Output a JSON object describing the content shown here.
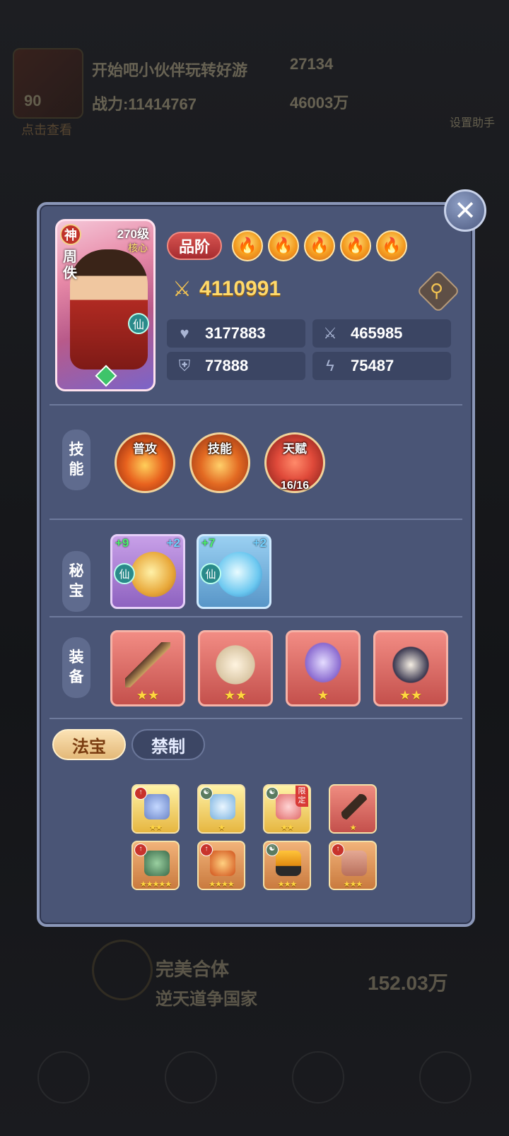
{
  "background": {
    "level": "90",
    "player_name": "开始吧小伙伴玩转好游",
    "power_hint": "战力:11414767",
    "stat_a": "27134",
    "stat_b": "46003万",
    "sub_label": "点击查看",
    "right_label": "设置助手",
    "bottom_line1": "完美合体",
    "bottom_line2": "逆天道争国家",
    "bottom_value": "152.03万"
  },
  "hero": {
    "rank": "神",
    "name": "周佚",
    "level": "270级",
    "core": "核心",
    "element": "仙"
  },
  "grade": {
    "label": "品阶",
    "flames": 5
  },
  "power": "4110991",
  "stats": {
    "hp": "3177883",
    "attack": "465985",
    "defense": "77888",
    "resist": "75487"
  },
  "sections": {
    "skills": "技能",
    "treasures": "秘宝",
    "equipment": "装备"
  },
  "skills": [
    {
      "label": "普攻",
      "sub": ""
    },
    {
      "label": "技能",
      "sub": ""
    },
    {
      "label": "天赋",
      "sub": "16/16"
    }
  ],
  "treasures": [
    {
      "plus_left": "+9",
      "plus_right": "+2",
      "element": "仙"
    },
    {
      "plus_left": "+7",
      "plus_right": "+2",
      "element": "仙"
    }
  ],
  "equipment": [
    {
      "stars": "★★"
    },
    {
      "stars": "★★"
    },
    {
      "stars": "★"
    },
    {
      "stars": "★★"
    }
  ],
  "tabs": {
    "active": "法宝",
    "inactive": "禁制"
  },
  "fabao": [
    {
      "stars": "★★",
      "limited": ""
    },
    {
      "stars": "★",
      "limited": ""
    },
    {
      "stars": "★★",
      "limited": "限定"
    },
    {
      "stars": "★",
      "limited": ""
    },
    {
      "stars": "★★★★★",
      "limited": ""
    },
    {
      "stars": "★★★★",
      "limited": ""
    },
    {
      "stars": "★★★",
      "limited": ""
    },
    {
      "stars": "★★★",
      "limited": ""
    }
  ]
}
